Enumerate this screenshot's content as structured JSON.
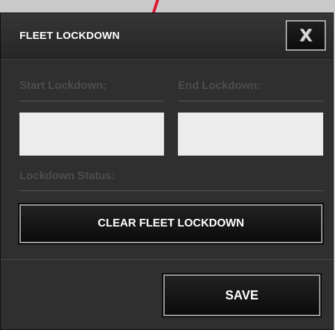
{
  "dialog": {
    "title": "FLEET LOCKDOWN",
    "close_label": "X"
  },
  "fields": {
    "start_label": "Start Lockdown:",
    "start_value": "",
    "end_label": "End Lockdown:",
    "end_value": "",
    "status_label": "Lockdown Status:"
  },
  "buttons": {
    "clear_label": "CLEAR FLEET LOCKDOWN",
    "save_label": "SAVE"
  },
  "colors": {
    "annotation": "#e0102a",
    "dialog_bg": "#2f2f2f",
    "field_bg": "#ececec"
  }
}
